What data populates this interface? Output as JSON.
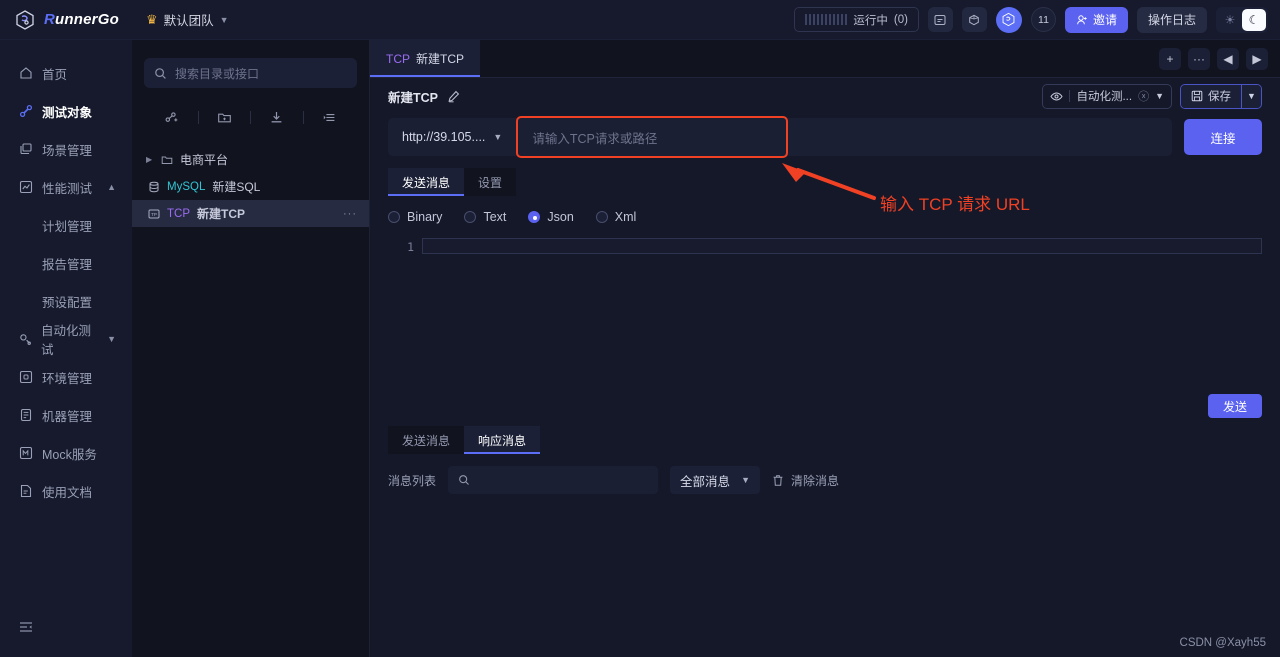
{
  "brand": {
    "name_r": "R",
    "name_rest": "unnerGo",
    "logo_icon": "runnergo-logo-icon"
  },
  "team": {
    "label": "默认团队",
    "crown_icon": "crown-icon",
    "caret_icon": "chevron-down-icon"
  },
  "header": {
    "status_text": "运行中",
    "status_count": "(0)",
    "icon1": "calendar-icon",
    "icon2": "cube-icon",
    "badge_count": "11",
    "invite_label": "邀请",
    "invite_icon": "user-add-icon",
    "log_label": "操作日志",
    "sun_icon": "sun-icon",
    "moon_icon": "moon-icon"
  },
  "sidebar": {
    "items": [
      {
        "label": "首页",
        "icon": "home-icon",
        "type": "item",
        "active": false
      },
      {
        "label": "测试对象",
        "icon": "link-icon",
        "type": "item",
        "active": true
      },
      {
        "label": "场景管理",
        "icon": "layers-icon",
        "type": "item",
        "active": false
      },
      {
        "label": "性能测试",
        "icon": "chart-icon",
        "type": "group",
        "chevron": "chevron-up-icon",
        "active": false
      },
      {
        "label": "计划管理",
        "type": "sub"
      },
      {
        "label": "报告管理",
        "type": "sub"
      },
      {
        "label": "预设配置",
        "type": "sub"
      },
      {
        "label": "自动化测试",
        "icon": "gear-flask-icon",
        "type": "group",
        "chevron": "chevron-down-icon",
        "active": false
      },
      {
        "label": "环境管理",
        "icon": "env-icon",
        "type": "item",
        "active": false
      },
      {
        "label": "机器管理",
        "icon": "server-icon",
        "type": "item",
        "active": false
      },
      {
        "label": "Mock服务",
        "icon": "mock-icon",
        "type": "item",
        "active": false
      },
      {
        "label": "使用文档",
        "icon": "doc-icon",
        "type": "item",
        "active": false
      }
    ],
    "collapse_icon": "collapse-sidebar-icon"
  },
  "tree": {
    "search_placeholder": "搜索目录或接口",
    "search_icon": "search-icon",
    "tools": [
      {
        "name": "add-api-icon"
      },
      {
        "name": "add-folder-icon"
      },
      {
        "name": "import-icon"
      },
      {
        "name": "filter-list-icon"
      }
    ],
    "rows": [
      {
        "kind": "folder",
        "name": "电商平台",
        "arrow": "chevron-right-icon",
        "icon": "folder-icon"
      },
      {
        "kind": "api",
        "tag": "MySQL",
        "name": "新建SQL",
        "icon": "database-icon"
      },
      {
        "kind": "api",
        "tag": "TCP",
        "name": "新建TCP",
        "icon": "tcp-icon",
        "selected": true,
        "more": "···"
      }
    ]
  },
  "main": {
    "tab": {
      "tag": "TCP",
      "label": "新建TCP"
    },
    "tab_controls": [
      {
        "name": "add-tab-button",
        "glyph": "+"
      },
      {
        "name": "tab-more-button",
        "glyph": "···"
      },
      {
        "name": "tab-prev-button",
        "glyph": "◀"
      },
      {
        "name": "tab-next-button",
        "glyph": "▶"
      }
    ],
    "doc_title": "新建TCP",
    "edit_icon": "pencil-icon",
    "env_select": {
      "value": "自动化测...",
      "eye_icon": "eye-icon",
      "clear_icon": "clear-circle-icon",
      "caret": "chevron-down-icon"
    },
    "save_label": "保存",
    "save_icon": "save-icon",
    "save_caret": "chevron-down-icon",
    "url_protocol": "http://39.105....",
    "url_protocol_caret": "chevron-down-icon",
    "url_placeholder": "请输入TCP请求或路径",
    "connect_label": "连接",
    "body_tabs": [
      {
        "label": "发送消息",
        "active": true
      },
      {
        "label": "设置",
        "active": false
      }
    ],
    "format_options": [
      {
        "label": "Binary",
        "selected": false
      },
      {
        "label": "Text",
        "selected": false
      },
      {
        "label": "Json",
        "selected": true
      },
      {
        "label": "Xml",
        "selected": false
      }
    ],
    "editor_line_number": "1",
    "editor_content": "",
    "send_label": "发送",
    "response_tabs": [
      {
        "label": "发送消息",
        "active": false
      },
      {
        "label": "响应消息",
        "active": true
      }
    ],
    "message_list_label": "消息列表",
    "message_search_placeholder": "",
    "message_search_icon": "search-icon",
    "message_filter": "全部消息",
    "message_filter_caret": "chevron-down-icon",
    "clear_messages_label": "清除消息",
    "clear_messages_icon": "trash-icon"
  },
  "annotation": {
    "text": "输入 TCP 请求 URL",
    "color": "#f04124",
    "arrow_icon": "annotation-arrow-icon"
  },
  "watermark": "CSDN @Xayh55",
  "colors": {
    "accent": "#5b62f0",
    "tcp_tag": "#9b6df2",
    "mysql_tag": "#32c5d2",
    "annotation": "#f04124",
    "bg": "#11131f",
    "panel": "#161a2c"
  }
}
